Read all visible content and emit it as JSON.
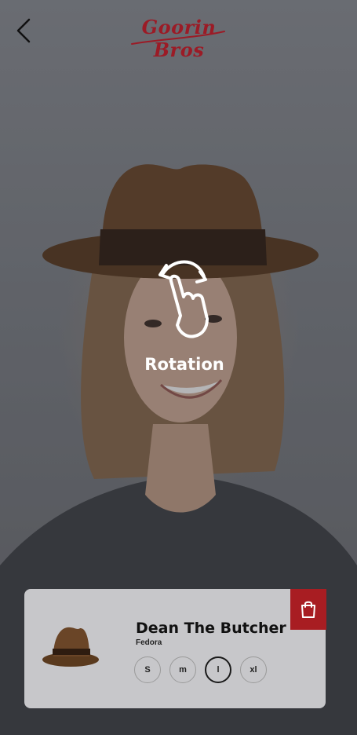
{
  "header": {
    "back_icon": "chevron-left-icon",
    "logo_text": "Goorin Bros"
  },
  "overlay": {
    "gesture_icon": "rotate-gesture-icon",
    "hint_label": "Rotation"
  },
  "product": {
    "name": "Dean The Butcher",
    "type": "Fedora",
    "cart_icon": "shopping-bag-icon",
    "sizes": [
      "S",
      "m",
      "l",
      "xl"
    ],
    "selected_size": "l"
  },
  "colors": {
    "brand": "#9b1b26",
    "cart_button": "#a81d22",
    "hat": "#5a3a1e"
  }
}
